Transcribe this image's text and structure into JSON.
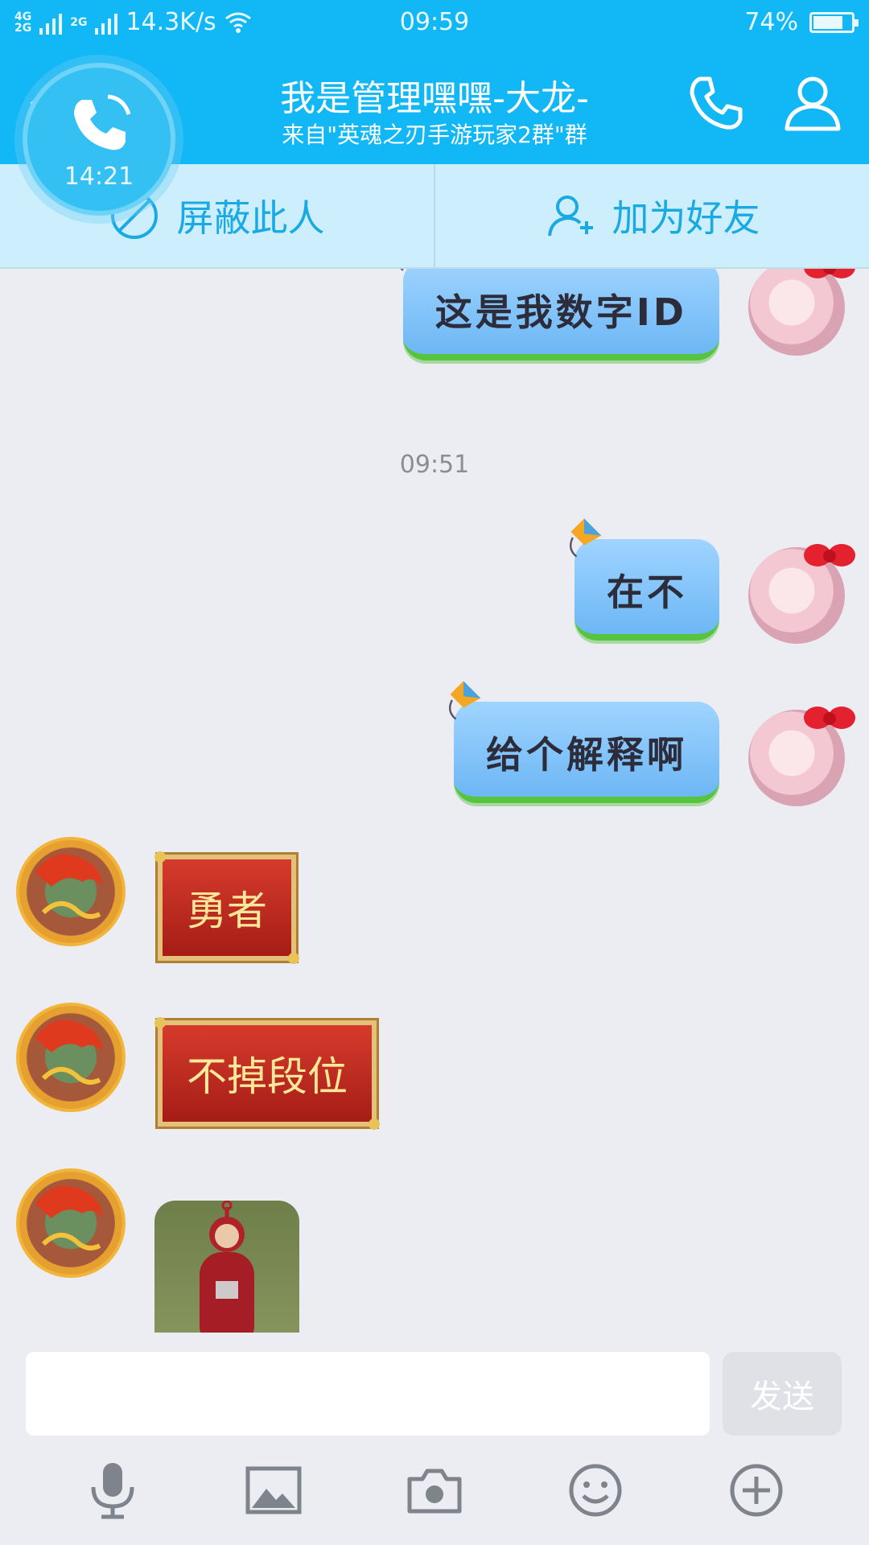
{
  "status_bar": {
    "network_top": "4G",
    "network_bottom": "2G",
    "network_2g": "2G",
    "speed": "14.3K/s",
    "time": "09:59",
    "battery": "74%"
  },
  "header": {
    "title": "我是管理嘿嘿-大龙-",
    "subtitle": "来自\"英魂之刃手游玩家2群\"群",
    "back_icon": "chevron-left-icon",
    "call_icon": "phone-icon",
    "profile_icon": "user-icon"
  },
  "call_floating": {
    "duration": "14:21"
  },
  "actions": {
    "block": "屏蔽此人",
    "add_friend": "加为好友"
  },
  "messages": {
    "m1": "这是我数字ID",
    "timestamp": "09:51",
    "m2": "在不",
    "m3": "给个解释啊",
    "m4": "勇者",
    "m5": "不掉段位"
  },
  "composer": {
    "input_value": "",
    "send": "发送"
  },
  "toolbar_icons": [
    "microphone-icon",
    "image-icon",
    "camera-icon",
    "emoji-icon",
    "plus-icon"
  ],
  "colors": {
    "brand": "#12b7f5",
    "action_bar": "#cdeefc",
    "chat_bg": "#ebedf2"
  }
}
